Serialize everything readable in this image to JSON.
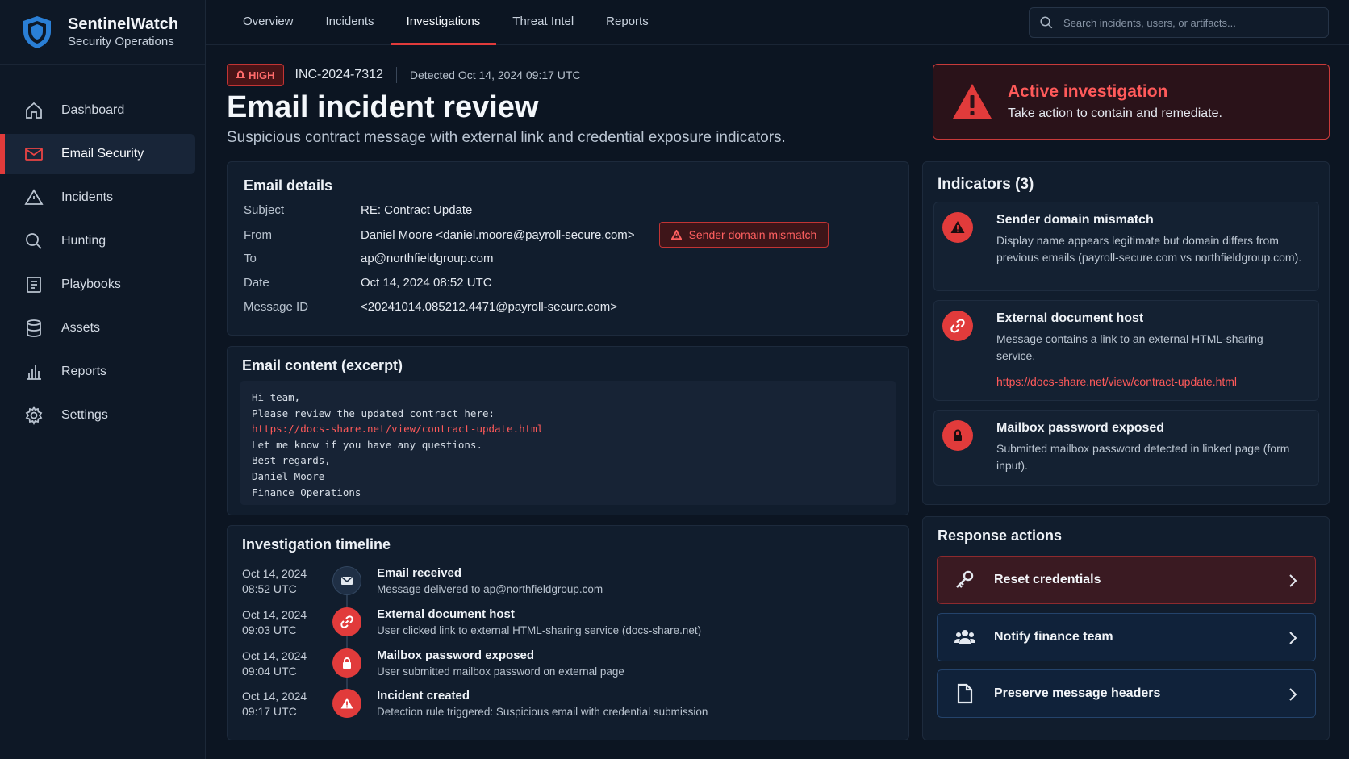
{
  "brand": {
    "title": "SentinelWatch",
    "subtitle": "Security Operations"
  },
  "sidebar": {
    "items": [
      {
        "label": "Dashboard",
        "icon": "home-icon",
        "active": false
      },
      {
        "label": "Email Security",
        "icon": "mail-icon",
        "active": true
      },
      {
        "label": "Incidents",
        "icon": "warning-icon",
        "active": false
      },
      {
        "label": "Hunting",
        "icon": "search-icon",
        "active": false
      },
      {
        "label": "Playbooks",
        "icon": "document-icon",
        "active": false
      },
      {
        "label": "Assets",
        "icon": "database-icon",
        "active": false
      },
      {
        "label": "Reports",
        "icon": "bar-chart-icon",
        "active": false
      },
      {
        "label": "Settings",
        "icon": "gear-icon",
        "active": false
      }
    ]
  },
  "topnav": {
    "tabs": [
      {
        "label": "Overview",
        "active": false
      },
      {
        "label": "Incidents",
        "active": false
      },
      {
        "label": "Investigations",
        "active": true
      },
      {
        "label": "Threat Intel",
        "active": false
      },
      {
        "label": "Reports",
        "active": false
      }
    ],
    "search_placeholder": "Search incidents, users, or artifacts..."
  },
  "incident": {
    "severity": "HIGH",
    "id": "INC-2024-7312",
    "detected": "Detected Oct 14, 2024 09:17 UTC",
    "title": "Email incident review",
    "subtitle": "Suspicious contract message with external link and credential exposure indicators."
  },
  "alert": {
    "title": "Active investigation",
    "text": "Take action to contain and remediate."
  },
  "email_details": {
    "title": "Email details",
    "rows": [
      {
        "label": "Subject",
        "value": "RE: Contract Update"
      },
      {
        "label": "From",
        "value": "Daniel Moore <daniel.moore@payroll-secure.com>"
      },
      {
        "label": "To",
        "value": "ap@northfieldgroup.com"
      },
      {
        "label": "Date",
        "value": "Oct 14, 2024 08:52 UTC"
      },
      {
        "label": "Message ID",
        "value": "<20241014.085212.4471@payroll-secure.com>"
      }
    ],
    "mismatch_badge": "Sender domain mismatch"
  },
  "email_content": {
    "title": "Email content (excerpt)",
    "lines": [
      "Hi team,",
      "Please review the updated contract here:",
      "https://docs-share.net/view/contract-update.html",
      "Let me know if you have any questions.",
      "Best regards,",
      "Daniel Moore",
      "Finance Operations"
    ]
  },
  "timeline": {
    "title": "Investigation timeline",
    "events": [
      {
        "date": "Oct 14, 2024",
        "time": "08:52 UTC",
        "title": "Email received",
        "desc": "Message delivered to ap@northfieldgroup.com",
        "icon": "mail-icon"
      },
      {
        "date": "Oct 14, 2024",
        "time": "09:03 UTC",
        "title": "External document host",
        "desc": "User clicked link to external HTML-sharing service (docs-share.net)",
        "icon": "link-icon"
      },
      {
        "date": "Oct 14, 2024",
        "time": "09:04 UTC",
        "title": "Mailbox password exposed",
        "desc": "User submitted mailbox password on external page",
        "icon": "lock-icon"
      },
      {
        "date": "Oct 14, 2024",
        "time": "09:17 UTC",
        "title": "Incident created",
        "desc": "Detection rule triggered: Suspicious email with credential submission",
        "icon": "warning-icon"
      }
    ]
  },
  "indicators": {
    "title": "Indicators (3)",
    "items": [
      {
        "title": "Sender domain mismatch",
        "desc": "Display name appears legitimate but domain differs from previous emails (payroll-secure.com vs northfieldgroup.com).",
        "icon": "warning-icon"
      },
      {
        "title": "External document host",
        "desc": "Message contains a link to an external HTML-sharing service.",
        "link": "https://docs-share.net/view/contract-update.html",
        "icon": "link-icon"
      },
      {
        "title": "Mailbox password exposed",
        "desc": "Submitted mailbox password detected in linked page (form input).",
        "icon": "lock-icon"
      }
    ]
  },
  "actions": {
    "title": "Response actions",
    "items": [
      {
        "label": "Reset credentials",
        "icon": "key-icon"
      },
      {
        "label": "Notify finance team",
        "icon": "users-icon"
      },
      {
        "label": "Preserve message headers",
        "icon": "file-icon"
      }
    ]
  },
  "colors": {
    "accent": "#e13b3b",
    "background": "#0c1522",
    "card": "#111d2d",
    "link": "#ff5a5a"
  }
}
